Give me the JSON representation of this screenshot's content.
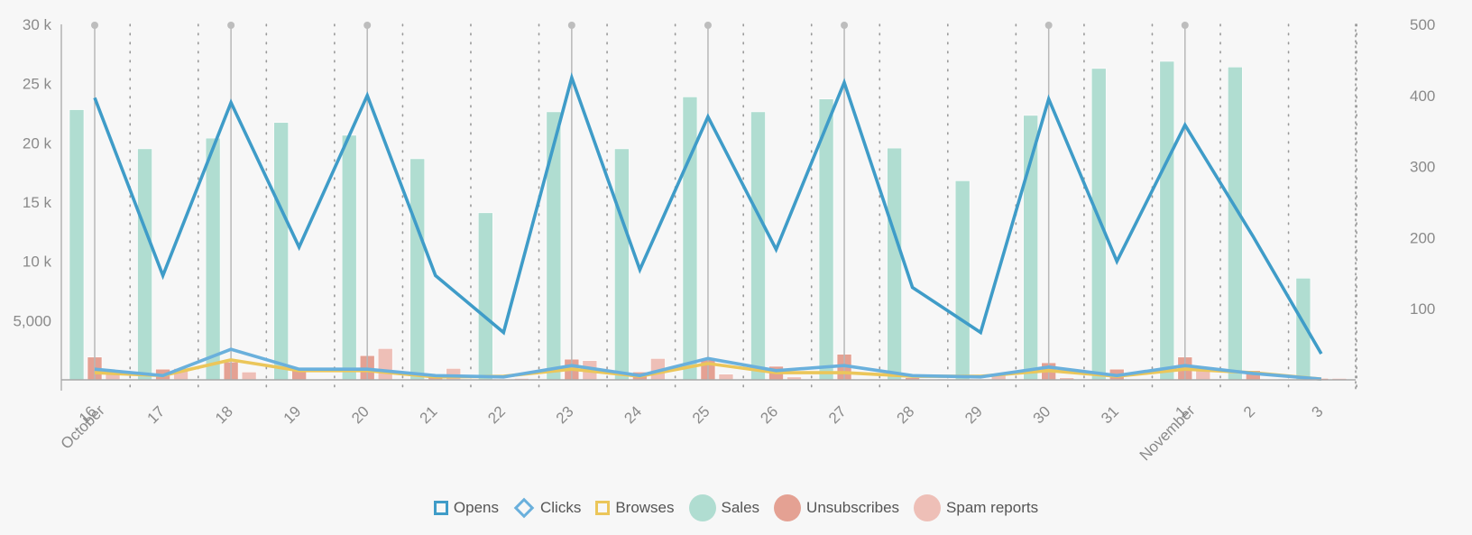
{
  "chart_data": {
    "type": "bar+line",
    "title": "",
    "xlabel": "",
    "ylabel_left": "",
    "ylabel_right": "",
    "x": [
      "16",
      "17",
      "18",
      "19",
      "20",
      "21",
      "22",
      "23",
      "24",
      "25",
      "26",
      "27",
      "28",
      "29",
      "30",
      "31",
      "1",
      "2",
      "3"
    ],
    "month_labels": [
      {
        "at": "16",
        "label": "October"
      },
      {
        "at": "1",
        "label": "November"
      }
    ],
    "event_markers": [
      "16",
      "18",
      "20",
      "23",
      "25",
      "27",
      "30",
      "1"
    ],
    "y_left": {
      "range": [
        0,
        30000
      ],
      "ticks": [
        5000,
        10000,
        15000,
        20000,
        25000,
        30000
      ],
      "tick_labels": [
        "5,000",
        "10 k",
        "15 k",
        "20 k",
        "25 k",
        "30 k"
      ]
    },
    "y_right": {
      "range": [
        0,
        500
      ],
      "ticks": [
        100,
        200,
        300,
        400,
        500
      ],
      "tick_labels": [
        "100",
        "200",
        "300",
        "400",
        "500"
      ]
    },
    "grid": "vertical-dotted",
    "legend_position": "bottom-center",
    "series": [
      {
        "name": "Opens",
        "kind": "line",
        "axis": "left",
        "color": "#3f9cc8",
        "values": [
          23800,
          8800,
          23400,
          11200,
          24000,
          8800,
          4000,
          25500,
          9300,
          22200,
          11000,
          25100,
          7800,
          4000,
          23700,
          10000,
          21500,
          12100,
          2200
        ]
      },
      {
        "name": "Clicks",
        "kind": "line",
        "axis": "right",
        "color": "#6ab0dc",
        "values": [
          15,
          6,
          43,
          15,
          15,
          6,
          4,
          20,
          6,
          30,
          13,
          20,
          6,
          4,
          18,
          6,
          20,
          9,
          1
        ]
      },
      {
        "name": "Browses",
        "kind": "line",
        "axis": "right",
        "color": "#ebc65a",
        "values": [
          10,
          6,
          28,
          13,
          13,
          4,
          5,
          15,
          5,
          23,
          10,
          10,
          5,
          5,
          13,
          5,
          15,
          10,
          1
        ]
      },
      {
        "name": "Sales",
        "kind": "bar",
        "axis": "right",
        "color": "#b0ddd1",
        "values": [
          380,
          325,
          340,
          362,
          344,
          311,
          235,
          377,
          325,
          398,
          377,
          395,
          326,
          280,
          372,
          438,
          448,
          440,
          143
        ]
      },
      {
        "name": "Unsubscribes",
        "kind": "bar",
        "axis": "right",
        "color": "#e4a193",
        "values": [
          32,
          15,
          25,
          13,
          34,
          8,
          1,
          29,
          11,
          30,
          19,
          36,
          3,
          1,
          24,
          15,
          32,
          13,
          2
        ]
      },
      {
        "name": "Spam reports",
        "kind": "bar",
        "axis": "right",
        "color": "#eebfb7",
        "values": [
          13,
          16,
          11,
          1,
          44,
          16,
          2,
          27,
          30,
          8,
          4,
          1,
          1,
          6,
          3,
          1,
          15,
          1,
          2
        ]
      }
    ]
  },
  "legend": {
    "items": [
      {
        "label": "Opens",
        "symbol": "square",
        "color": "#3f9cc8"
      },
      {
        "label": "Clicks",
        "symbol": "diamond",
        "color": "#6ab0dc"
      },
      {
        "label": "Browses",
        "symbol": "square",
        "color": "#ebc65a"
      },
      {
        "label": "Sales",
        "symbol": "circle",
        "color": "#b0ddd1"
      },
      {
        "label": "Unsubscribes",
        "symbol": "circle",
        "color": "#e4a193"
      },
      {
        "label": "Spam reports",
        "symbol": "circle",
        "color": "#eebfb7"
      }
    ]
  }
}
